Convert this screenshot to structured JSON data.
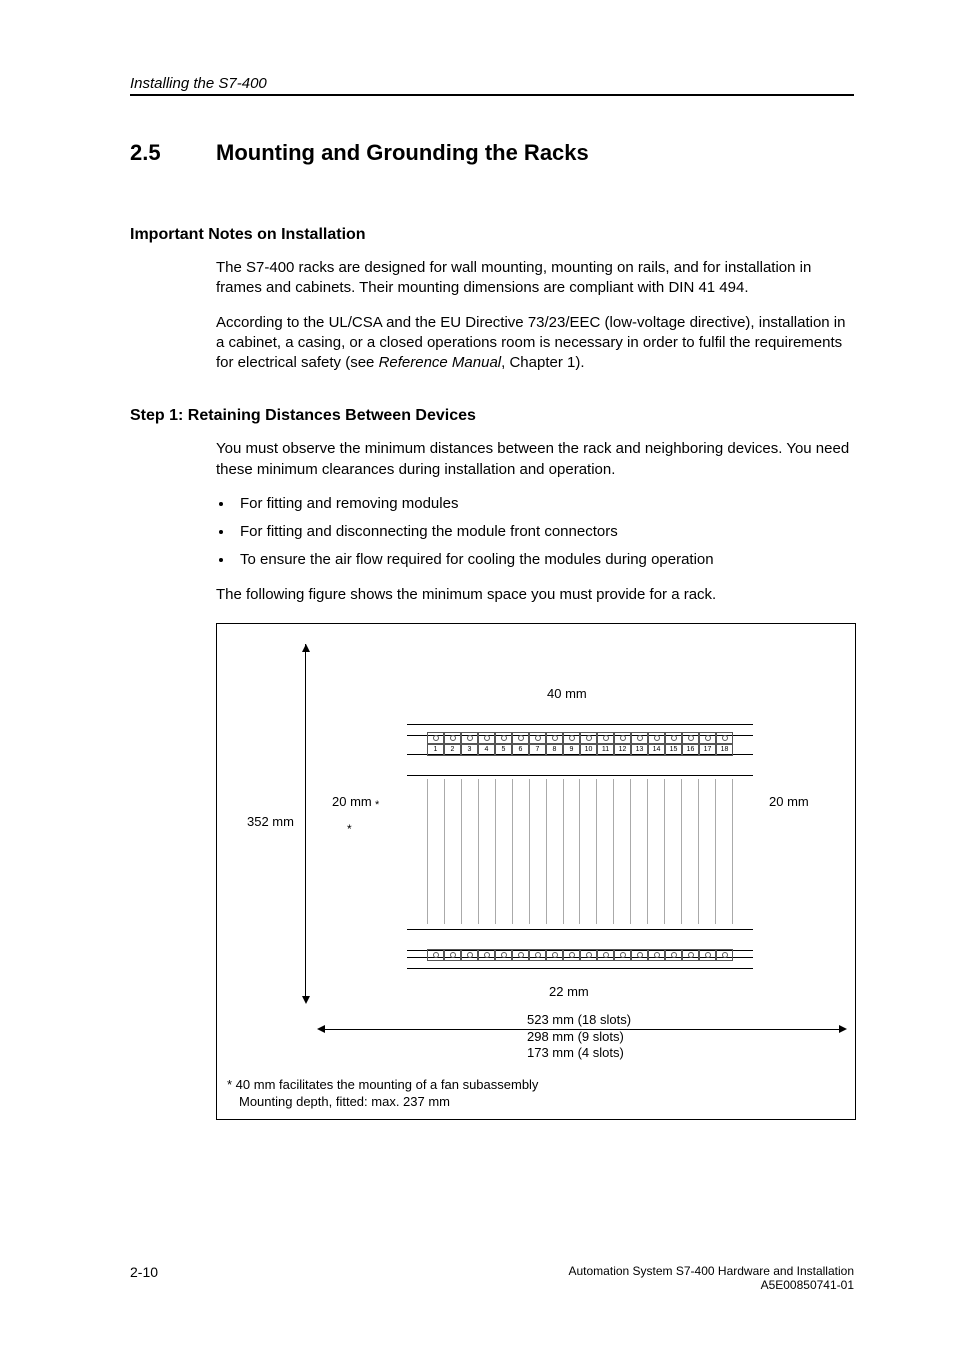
{
  "header": {
    "running": "Installing the S7-400"
  },
  "section": {
    "number": "2.5",
    "title": "Mounting and Grounding the Racks"
  },
  "notes": {
    "heading": "Important Notes on Installation",
    "p1": "The S7-400 racks are designed for wall mounting, mounting on rails, and for installation in frames and cabinets. Their mounting dimensions are compliant with DIN 41 494.",
    "p2a": "According to the UL/CSA and the EU Directive 73/23/EEC (low-voltage directive), installation in a cabinet, a casing, or a closed operations room is necessary in order to fulfil the requirements for electrical safety (see ",
    "p2b_italic": "Reference Manual",
    "p2c": ", Chapter 1)."
  },
  "step1": {
    "heading": "Step 1: Retaining Distances Between Devices",
    "p1": "You must observe the minimum distances between the rack and neighboring devices. You need these minimum clearances during installation and operation.",
    "li1": "For fitting and removing modules",
    "li2": "For fitting and disconnecting the module front connectors",
    "li3": "To ensure the air flow required for cooling the modules during operation",
    "p2": "The following figure shows the minimum space you must provide for a rack."
  },
  "figure": {
    "top_clearance": "40 mm",
    "left_clearance": "20 mm",
    "right_clearance": "20 mm",
    "bottom_clearance": "22 mm",
    "height_label": "352 mm",
    "star_mark": "*",
    "width_18": "523 mm (18 slots)",
    "width_9": "298 mm (9 slots)",
    "width_4": "173 mm (4 slots)",
    "footnote1": "*  40 mm facilitates the mounting of a fan subassembly",
    "footnote2": "Mounting depth, fitted: max. 237 mm",
    "slots": [
      "1",
      "2",
      "3",
      "4",
      "5",
      "6",
      "7",
      "8",
      "9",
      "10",
      "11",
      "12",
      "13",
      "14",
      "15",
      "16",
      "17",
      "18"
    ]
  },
  "footer": {
    "page": "2-10",
    "line1": "Automation System S7-400  Hardware and Installation",
    "line2": "A5E00850741-01"
  }
}
